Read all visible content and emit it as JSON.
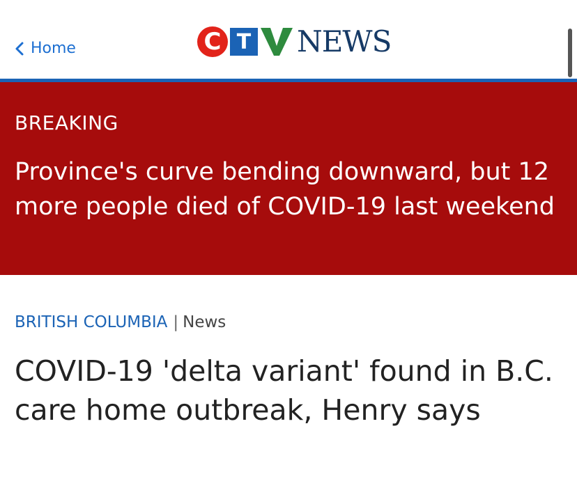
{
  "nav": {
    "back_label": "Home",
    "back_icon": "chevron-left-icon"
  },
  "logo": {
    "letter_c": "C",
    "letter_t": "T",
    "letter_v": "V",
    "wordmark": "NEWS",
    "colors": {
      "red": "#e2231a",
      "blue": "#1b63b5",
      "green": "#2e8b3e",
      "navy": "#163a66"
    }
  },
  "breaking": {
    "tag": "BREAKING",
    "headline": "Province's curve bending downward, but 12 more people died of COVID-19 last weekend",
    "background_color": "#a60c0c"
  },
  "article": {
    "section": "BRITISH COLUMBIA",
    "separator": "|",
    "type": "News",
    "headline": "COVID-19 'delta variant' found in B.C. care home outbreak, Henry says"
  },
  "colors": {
    "accent_blue": "#1b63b5",
    "link_blue": "#1d6fd1",
    "text_dark": "#222222"
  }
}
